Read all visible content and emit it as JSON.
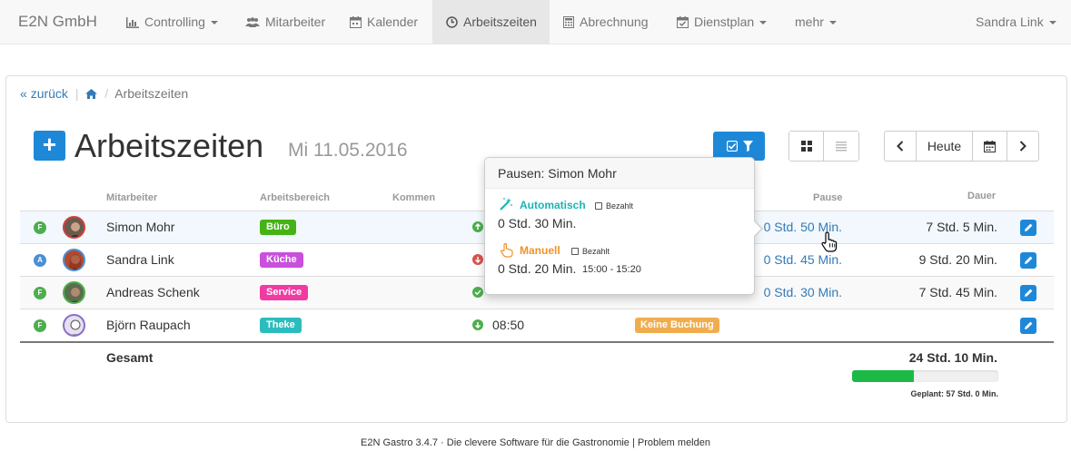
{
  "navbar": {
    "brand": "E2N GmbH",
    "items": [
      {
        "label": "Controlling",
        "icon": "bar-chart-icon"
      },
      {
        "label": "Mitarbeiter",
        "icon": "users-icon"
      },
      {
        "label": "Kalender",
        "icon": "calendar-icon"
      },
      {
        "label": "Arbeitszeiten",
        "icon": "clock-icon",
        "active": true
      },
      {
        "label": "Abrechnung",
        "icon": "calculator-icon"
      },
      {
        "label": "Dienstplan",
        "icon": "calendar-check-icon"
      },
      {
        "label": "mehr"
      }
    ],
    "user": "Sandra Link"
  },
  "breadcrumb": {
    "back": "zurück",
    "current": "Arbeitszeiten"
  },
  "header": {
    "title": "Arbeitszeiten",
    "date": "Mi 11.05.2016",
    "today_label": "Heute"
  },
  "table": {
    "columns": {
      "mitarbeiter": "Mitarbeiter",
      "arbeitsbereich": "Arbeitsbereich",
      "kommen": "Kommen",
      "pause": "Pause",
      "dauer": "Dauer"
    },
    "rows": [
      {
        "letter": "F",
        "letter_color": "#4cae4c",
        "name": "Simon Mohr",
        "area": "Büro",
        "area_color": "#45b316",
        "pause": "0 Std. 50 Min.",
        "dauer": "7 Std. 5 Min.",
        "kommen_icon": "arrow-up-circle-icon"
      },
      {
        "letter": "A",
        "letter_color": "#4a8fd6",
        "name": "Sandra Link",
        "area": "Küche",
        "area_color": "#c94fdd",
        "pause": "0 Std. 45 Min.",
        "dauer": "9 Std. 20 Min.",
        "kommen_icon": "arrow-down-circle-icon"
      },
      {
        "letter": "F",
        "letter_color": "#4cae4c",
        "name": "Andreas Schenk",
        "area": "Service",
        "area_color": "#f03ba2",
        "pause": "0 Std. 30 Min.",
        "dauer": "7 Std. 45 Min.",
        "kommen_icon": "check-circle-icon"
      },
      {
        "letter": "F",
        "letter_color": "#4cae4c",
        "name": "Björn Raupach",
        "area": "Theke",
        "area_color": "#2bbdbd",
        "kommen": "08:50",
        "status": "Keine Buchung",
        "kommen_icon": "arrow-down-circle-icon"
      }
    ],
    "total_label": "Gesamt",
    "total_value": "24 Std. 10 Min.",
    "progress_fraction": 0.42,
    "planned": "Geplant: 57 Std. 0 Min."
  },
  "popover": {
    "title": "Pausen: Simon Mohr",
    "auto_label": "Automatisch",
    "auto_bezahlt": "Bezahlt",
    "auto_duration": "0 Std. 30 Min.",
    "manual_label": "Manuell",
    "manual_bezahlt": "Bezahlt",
    "manual_duration": "0 Std. 20 Min.",
    "manual_time": "15:00 - 15:20"
  },
  "footer": "E2N Gastro 3.4.7 · Die clevere Software für die Gastronomie | Problem melden",
  "colors": {
    "primary": "#1e88d8",
    "success": "#1db946",
    "warning": "#f0ad4e",
    "link": "#337ab7"
  }
}
